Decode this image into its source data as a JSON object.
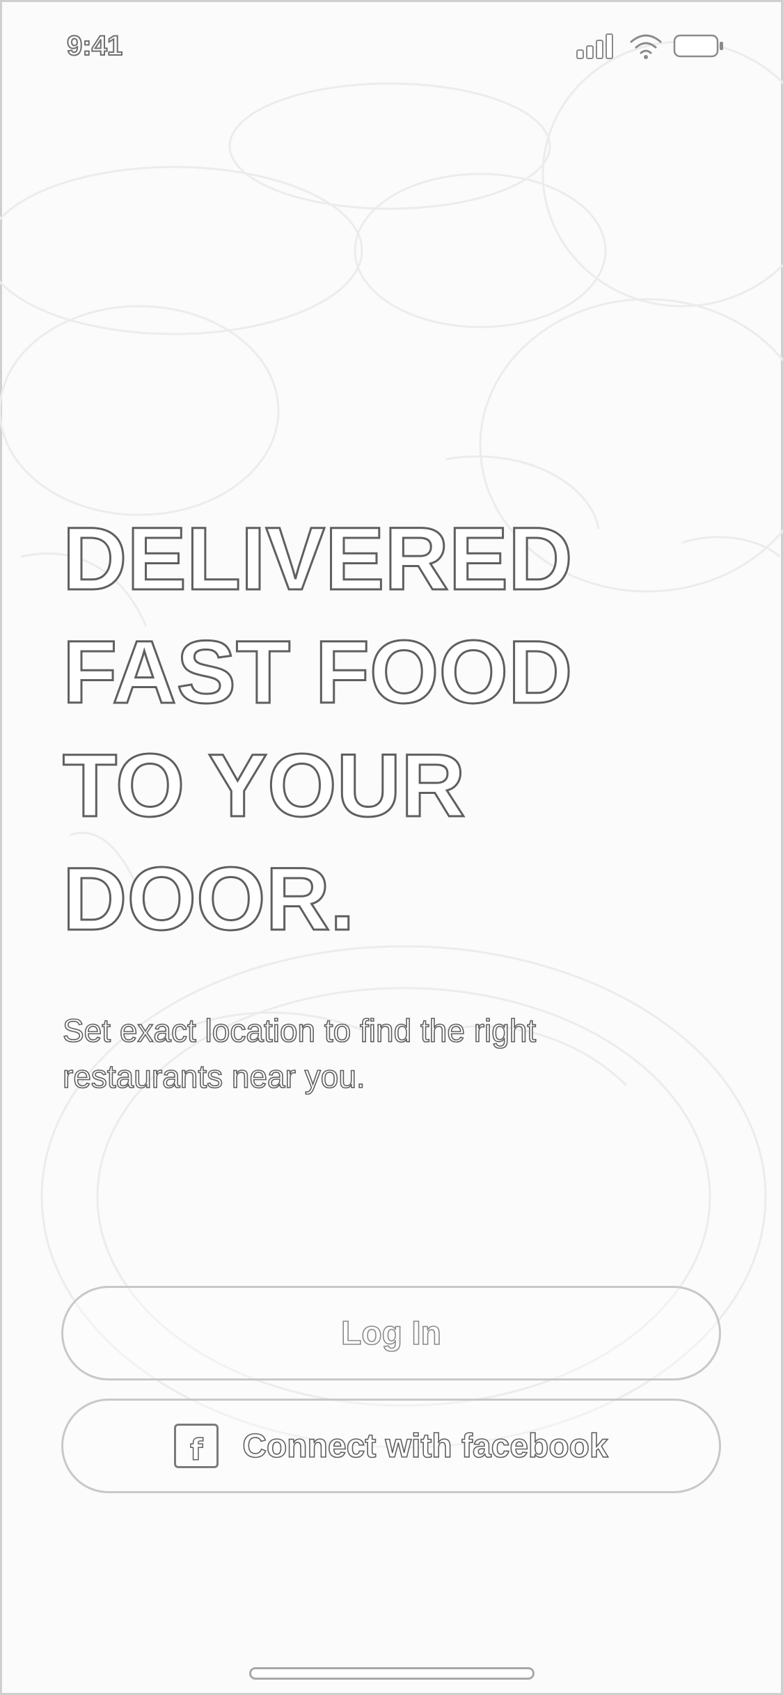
{
  "status_bar": {
    "time": "9:41",
    "icons": [
      "signal-icon",
      "wifi-icon",
      "battery-icon"
    ]
  },
  "hero": {
    "headline_lines": [
      "DELIVERED",
      "FAST FOOD",
      "TO YOUR",
      "DOOR."
    ],
    "subtitle_line1": "Set exact location to find the right",
    "subtitle_line2": "restaurants near you."
  },
  "actions": {
    "login_label": "Log In",
    "facebook_label": "Connect with facebook",
    "facebook_icon_glyph": "f"
  },
  "colors": {
    "background": "#fbfbfb",
    "outline": "#5f5f5f",
    "button_border": "#c8c8c8"
  }
}
